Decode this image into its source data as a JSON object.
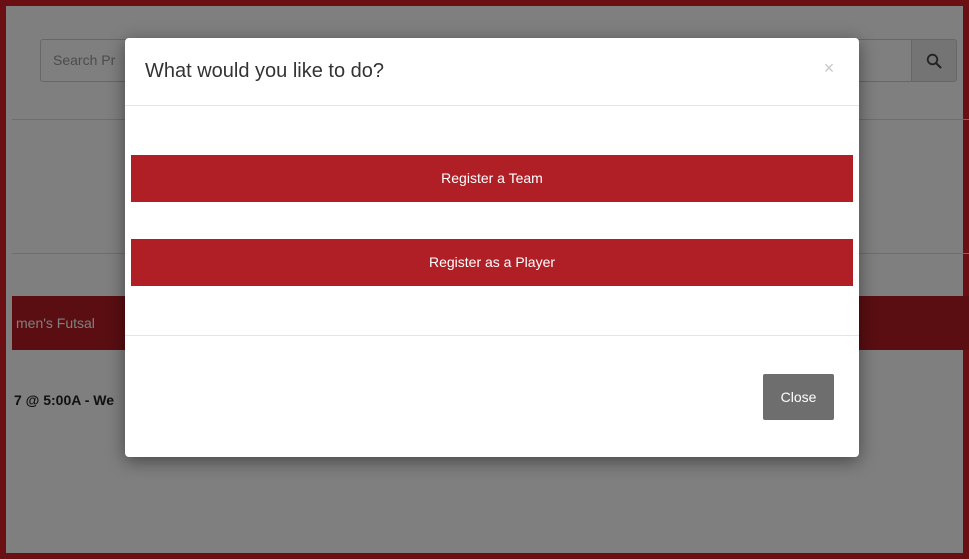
{
  "page": {
    "search": {
      "placeholder": "Search Pr"
    },
    "league_bar": {
      "label": "men's Futsal"
    },
    "event": {
      "text": "7 @ 5:00A - We"
    }
  },
  "modal": {
    "title": "What would you like to do?",
    "close_glyph": "×",
    "buttons": [
      {
        "label": "Register a Team"
      },
      {
        "label": "Register as a Player"
      }
    ],
    "footer_close_label": "Close"
  },
  "colors": {
    "brand_red": "#b01f26",
    "frame_red": "#d4202a",
    "close_button_gray": "#6e6e6e"
  },
  "icons": {
    "search": "search-icon",
    "close": "close-icon"
  }
}
